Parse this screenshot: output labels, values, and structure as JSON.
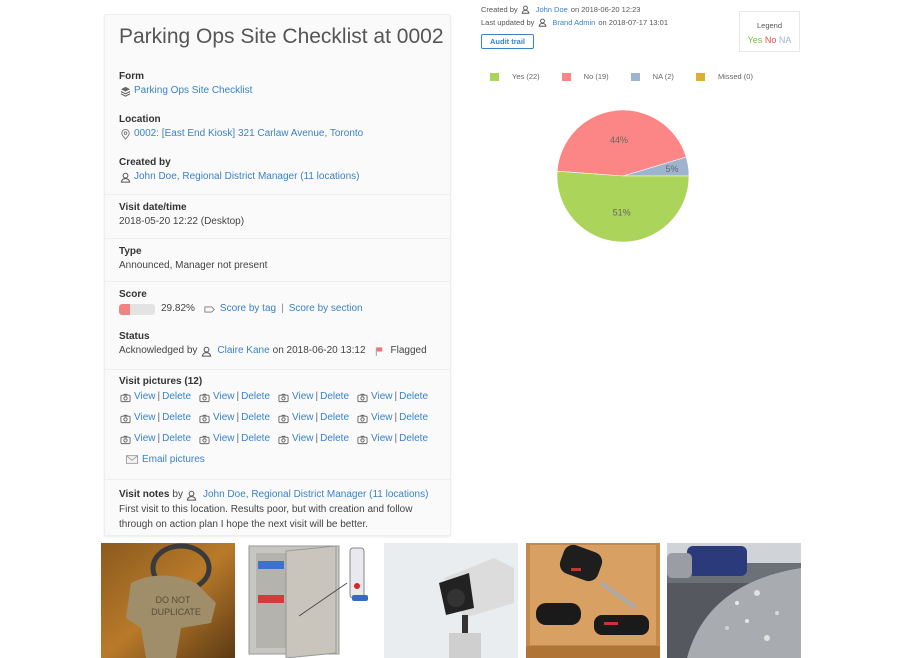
{
  "card": {
    "title": "Parking Ops Site Checklist at 0002",
    "form": {
      "label": "Form",
      "value": "Parking Ops Site Checklist",
      "icon": "layers-icon"
    },
    "location": {
      "label": "Location",
      "value": "0002: [East End Kiosk] 321 Carlaw Avenue, Toronto",
      "icon": "map-pin-icon"
    },
    "created_by": {
      "label": "Created by",
      "value": "John Doe, Regional District Manager (11 locations)",
      "icon": "user-icon"
    },
    "visit_datetime": {
      "label": "Visit date/time",
      "value": "2018-05-20 12:22 (Desktop)"
    },
    "type": {
      "label": "Type",
      "value": "Announced, Manager not present"
    },
    "score": {
      "label": "Score",
      "percent_text": "29.82%",
      "fraction": 0.2982,
      "bar_color": "#f28383",
      "by_tag": "Score by tag",
      "separator": "|",
      "by_section": "Score by section"
    },
    "status": {
      "label": "Status",
      "prefix": "Acknowledged by",
      "user": "Claire Kane",
      "on_text": "on 2018-06-20 13:12",
      "flag_label": "Flagged",
      "flag_color": "#f07474"
    },
    "pictures": {
      "label": "Visit pictures (12)",
      "view": "View",
      "separator": "|",
      "delete": "Delete",
      "count": 12,
      "email": "Email pictures"
    },
    "notes": {
      "label": "Visit notes",
      "by": "by",
      "user": "John Doe, Regional District Manager (11 locations)",
      "text": "First visit to this location. Results poor, but with creation and follow through on action plan I hope the next visit will be better."
    }
  },
  "meta": {
    "created_prefix": "Created by",
    "created_user": "John Doe",
    "created_on": "on 2018-06-20 12:23",
    "updated_prefix": "Last updated by",
    "updated_user": "Brand Admin",
    "updated_on": "on 2018-07-17 13:01",
    "audit_button": "Audit trail"
  },
  "legend": {
    "title": "Legend",
    "yes": "Yes",
    "no": "No",
    "na": "NA",
    "colors": {
      "yes": "#7cbd3c",
      "no": "#f04e4e",
      "na": "#9fb4d0"
    }
  },
  "chart_data": {
    "type": "pie",
    "title": "",
    "legend_position": "top",
    "slices": [
      {
        "name": "Yes",
        "legend_label": "Yes (22)",
        "count": 22,
        "percent_label": "51%",
        "color": "#aad45a"
      },
      {
        "name": "No",
        "legend_label": "No (19)",
        "count": 19,
        "percent_label": "44%",
        "color": "#fc8686"
      },
      {
        "name": "NA",
        "legend_label": "NA (2)",
        "count": 2,
        "percent_label": "5%",
        "color": "#9db4cf"
      },
      {
        "name": "Missed",
        "legend_label": "Missed (0)",
        "count": 0,
        "percent_label": "",
        "color": "#dfb02f"
      }
    ]
  },
  "photos": [
    {
      "name": "photo-do-not-duplicate-key"
    },
    {
      "name": "photo-key-cabinet"
    },
    {
      "name": "photo-security-camera"
    },
    {
      "name": "photo-car-keys-drawer"
    },
    {
      "name": "photo-damaged-car-hood"
    }
  ]
}
